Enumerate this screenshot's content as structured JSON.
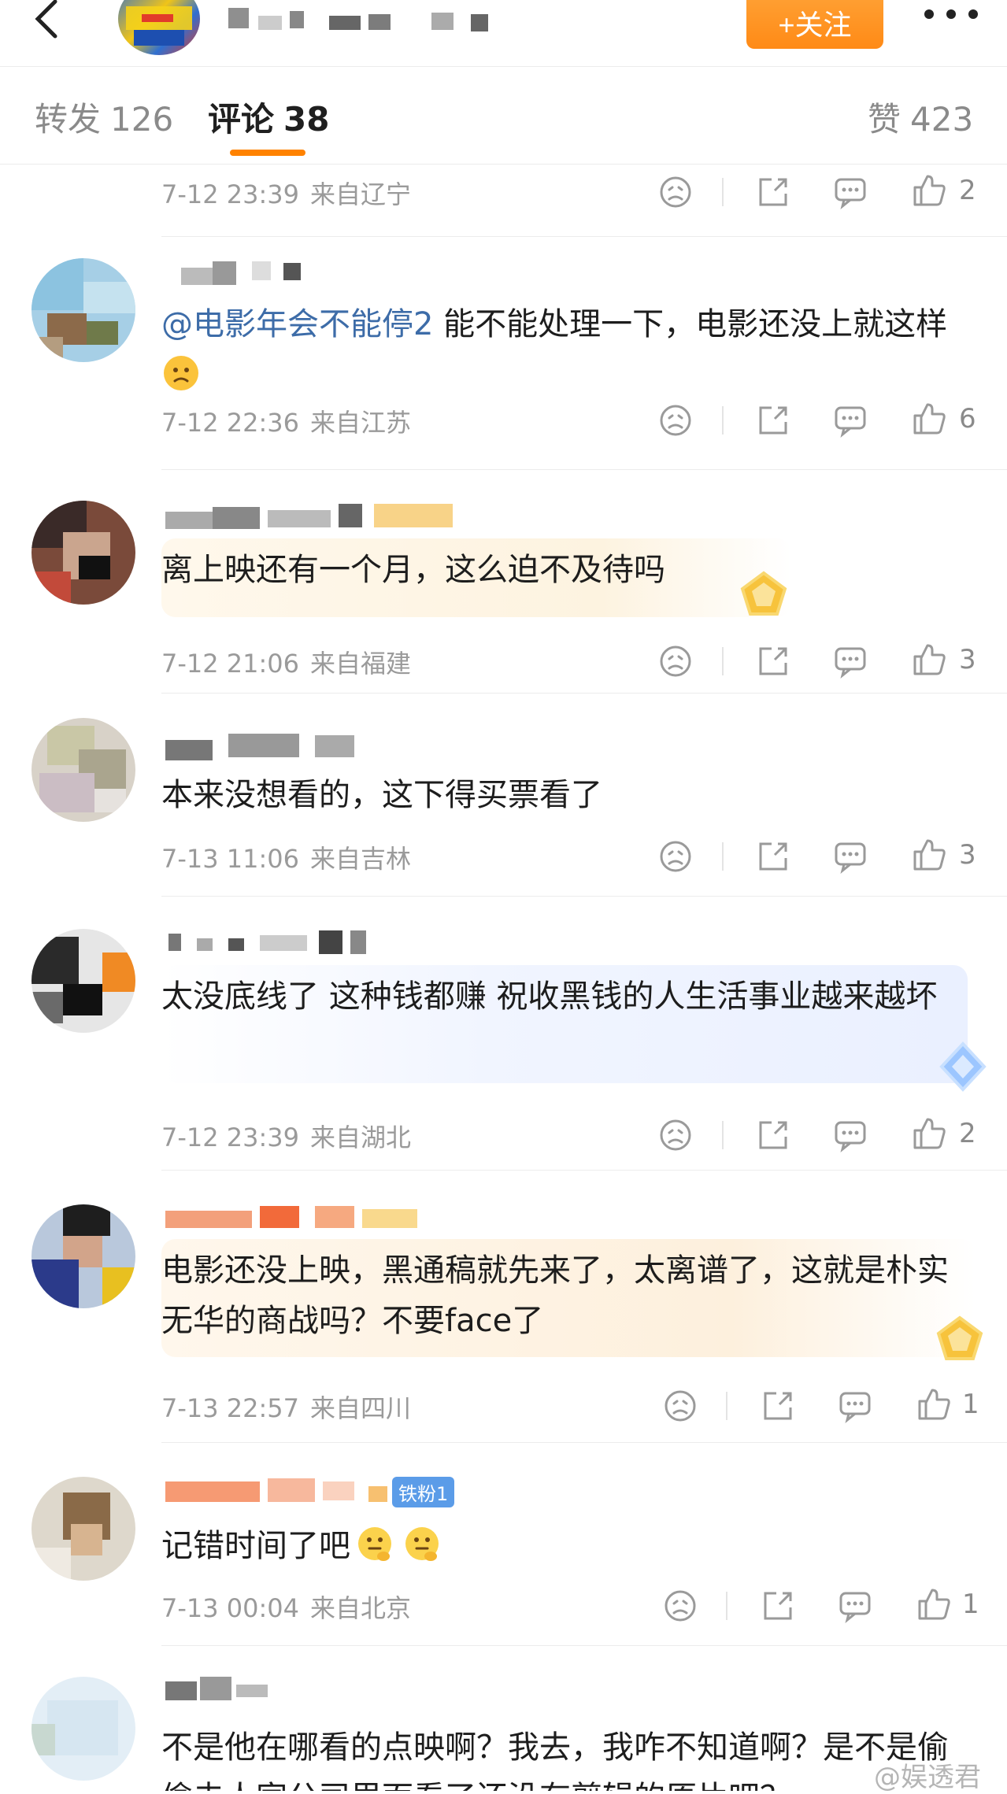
{
  "header": {
    "follow_label": "+关注",
    "back_icon": "chevron-left-icon",
    "more_icon": "more-dots-icon"
  },
  "tabs": {
    "repost": {
      "label": "转发",
      "count": "126"
    },
    "comments": {
      "label": "评论",
      "count": "38"
    },
    "likes": {
      "label": "赞",
      "count": "423"
    }
  },
  "colors": {
    "accent": "#ff8200",
    "mention": "#3d6ca8",
    "meta": "#9a9a9a"
  },
  "comments": [
    {
      "date": "7-12 23:39",
      "location": "来自辽宁",
      "likes": "2"
    },
    {
      "mention": "@电影年会不能停2",
      "text": " 能不能处理一下，电影还没上就这样",
      "emoji": "confused-face-icon",
      "date": "7-12 22:36",
      "location": "来自江苏",
      "likes": "6"
    },
    {
      "text": "离上映还有一个月，这么迫不及待吗",
      "date": "7-12 21:06",
      "location": "来自福建",
      "likes": "3"
    },
    {
      "text": "本来没想看的，这下得买票看了",
      "date": "7-13 11:06",
      "location": "来自吉林",
      "likes": "3"
    },
    {
      "text": "太没底线了 这种钱都赚 祝收黑钱的人生活事业越来越坏",
      "date": "7-12 23:39",
      "location": "来自湖北",
      "likes": "2"
    },
    {
      "text": "电影还没上映，黑通稿就先来了，太离谱了，这就是朴实无华的商战吗？不要face了",
      "date": "7-13 22:57",
      "location": "来自四川",
      "likes": "1"
    },
    {
      "text": "记错时间了吧",
      "fan_badge": "铁粉1",
      "emoji": "thinking-face-icon",
      "date": "7-13 00:04",
      "location": "来自北京",
      "likes": "1"
    },
    {
      "text": "不是他在哪看的点映啊？我去，我咋不知道啊？是不是偷偷去人家公司里面看了还没有剪辑的原片吧？"
    }
  ],
  "watermark": "@娱透君"
}
